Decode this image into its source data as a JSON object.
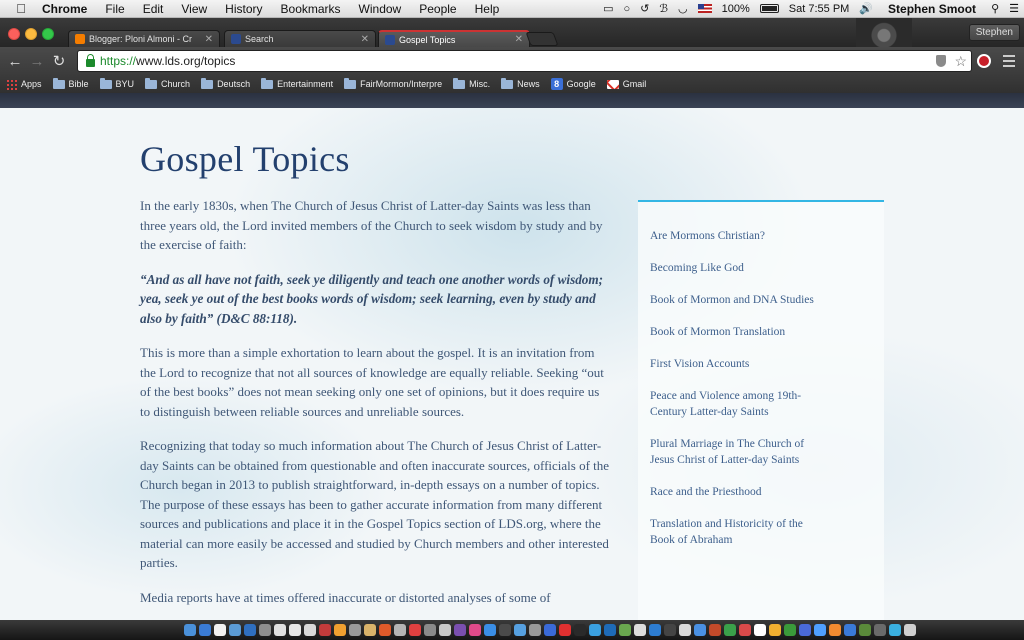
{
  "menubar": {
    "app": "Chrome",
    "menus": [
      "File",
      "Edit",
      "View",
      "History",
      "Bookmarks",
      "Window",
      "People",
      "Help"
    ],
    "battery": "100%",
    "clock": "Sat 7:55 PM",
    "user": "Stephen Smoot"
  },
  "tabs": [
    {
      "title": "Blogger: Ploni Almoni - Cr",
      "icon": "blogger-icon"
    },
    {
      "title": "Search",
      "icon": "lds-icon"
    },
    {
      "title": "Gospel Topics",
      "icon": "lds-icon"
    }
  ],
  "profile": "Stephen",
  "address": {
    "scheme": "https://",
    "rest": "www.lds.org/topics"
  },
  "bookmarks": [
    "Apps",
    "Bible",
    "BYU",
    "Church",
    "Deutsch",
    "Entertainment",
    "FairMormon/Interpre",
    "Misc.",
    "News",
    "Google",
    "Gmail"
  ],
  "page": {
    "title": "Gospel Topics",
    "paragraphs": [
      "In the early 1830s, when The Church of Jesus Christ of Latter-day Saints was less than three years old, the Lord invited members of the Church to seek wisdom by study and by the exercise of faith:",
      "“And as all have not faith, seek ye diligently and teach one another words of wisdom; yea, seek ye out of the best books words of wisdom; seek learning, even by study and also by faith” (D&C 88:118).",
      "This is more than a simple exhortation to learn about the gospel. It is an invitation from the Lord to recognize that not all sources of knowledge are equally reliable. Seeking “out of the best books” does not mean seeking only one set of opinions, but it does require us to distinguish between reliable sources and unreliable sources.",
      "Recognizing that today so much information about The Church of Jesus Christ of Latter-day Saints can be obtained from questionable and often inaccurate sources, officials of the Church began in 2013 to publish straightforward, in-depth essays on a number of topics. The purpose of these essays has been to gather accurate information from many different sources and publications and place it in the Gospel Topics section of LDS.org, where the material can more easily be accessed and studied by Church members and other interested parties.",
      "Media reports have at times offered inaccurate or distorted analyses of some of"
    ],
    "sidebar_links": [
      "Are Mormons Christian?",
      "Becoming Like God",
      "Book of Mormon and DNA Studies",
      "Book of Mormon Translation",
      "First Vision Accounts",
      "Peace and Violence among 19th-Century Latter-day Saints",
      "Plural Marriage in The Church of Jesus Christ of Latter-day Saints",
      "Race and the Priesthood",
      "Translation and Historicity of the Book of Abraham"
    ]
  },
  "colors": {
    "accent_rule": "#34b6e4",
    "title": "#23406e",
    "body_text": "#3f5777",
    "link": "#3d5f8c"
  },
  "dock_colors": [
    "#4a90d9",
    "#3a7bd5",
    "#f2f2f2",
    "#5b9bd5",
    "#2f6fbf",
    "#8e8e8e",
    "#e0e0e0",
    "#e8e8e8",
    "#d9d9d9",
    "#c23b3b",
    "#f0a030",
    "#9a9a9a",
    "#d9b36a",
    "#e05a2a",
    "#b5b5b5",
    "#e04040",
    "#8a8a8a",
    "#c9c9c9",
    "#7a4fb0",
    "#e04a8a",
    "#3a8ee6",
    "#4a4a4a",
    "#56a0e0",
    "#999999",
    "#3a6ad8",
    "#e03030",
    "#2a2a2a",
    "#3aa0e0",
    "#1e6bb8",
    "#6aa84f",
    "#dddddd",
    "#2d7dd2",
    "#444444",
    "#d9d9d9",
    "#4a90e2",
    "#c24a2a",
    "#3aa04a",
    "#d94a4a",
    "#ffffff",
    "#f0b030",
    "#3a9a3a",
    "#4a6ad8",
    "#4fa0ff",
    "#f28b30",
    "#3a7ad8",
    "#5a8a3a",
    "#6a6a6a",
    "#3ab0e0",
    "#d0d0d0"
  ]
}
